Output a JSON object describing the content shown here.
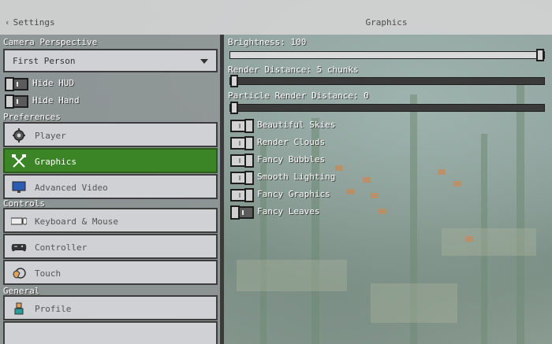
{
  "header": {
    "back_label": "Settings",
    "title": "Graphics"
  },
  "left": {
    "camera_perspective_label": "Camera Perspective",
    "camera_perspective_value": "First Person",
    "toggles": [
      {
        "label": "Hide HUD",
        "on": false
      },
      {
        "label": "Hide Hand",
        "on": false
      }
    ],
    "sections": [
      {
        "label": "Preferences",
        "items": [
          {
            "label": "Player",
            "icon": "gear-icon",
            "active": false
          },
          {
            "label": "Graphics",
            "icon": "tools-icon",
            "active": true
          },
          {
            "label": "Advanced Video",
            "icon": "monitor-icon",
            "active": false
          }
        ]
      },
      {
        "label": "Controls",
        "items": [
          {
            "label": "Keyboard & Mouse",
            "icon": "keyboard-mouse-icon",
            "active": false
          },
          {
            "label": "Controller",
            "icon": "gamepad-icon",
            "active": false
          },
          {
            "label": "Touch",
            "icon": "touch-icon",
            "active": false
          }
        ]
      },
      {
        "label": "General",
        "items": [
          {
            "label": "Profile",
            "icon": "profile-icon",
            "active": false
          }
        ]
      }
    ]
  },
  "right": {
    "sliders": [
      {
        "label": "Brightness: 100",
        "value": 1.0
      },
      {
        "label": "Render Distance: 5 chunks",
        "value": 0.0
      },
      {
        "label": "Particle Render Distance: 0",
        "value": 0.0
      }
    ],
    "toggles": [
      {
        "label": "Beautiful Skies",
        "on": true
      },
      {
        "label": "Render Clouds",
        "on": true
      },
      {
        "label": "Fancy Bubbles",
        "on": true
      },
      {
        "label": "Smooth Lighting",
        "on": true
      },
      {
        "label": "Fancy Graphics",
        "on": true
      },
      {
        "label": "Fancy Leaves",
        "on": false
      }
    ]
  },
  "colors": {
    "active_green": "#3c8527",
    "panel_button": "#d0d1d4"
  }
}
